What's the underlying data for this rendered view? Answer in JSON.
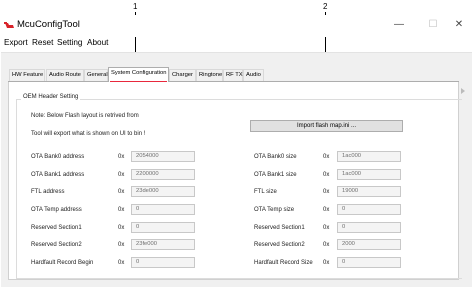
{
  "window": {
    "title": "McuConfigTool",
    "controls": {
      "minimize": "—",
      "maximize": "☐",
      "close": "✕"
    }
  },
  "menu": [
    "Export",
    "Reset",
    "Setting",
    "About"
  ],
  "tabs": [
    {
      "label": "HW Feature",
      "active": false
    },
    {
      "label": "Audio Route",
      "active": false
    },
    {
      "label": "General",
      "active": false
    },
    {
      "label": "System Configuration",
      "active": true
    },
    {
      "label": "Charger",
      "active": false
    },
    {
      "label": "Ringtone",
      "active": false
    },
    {
      "label": "RF TX",
      "active": false
    },
    {
      "label": "Audio",
      "active": false
    }
  ],
  "group": {
    "title": "OEM Header Setting",
    "note": "Note: Below Flash layout is retrived  from",
    "export_note": "Tool will export what is shown on UI to bin !",
    "import_button": "Import flash map.ini ..."
  },
  "hex_prefix": "0x",
  "left_fields": [
    {
      "label": "OTA Bank0 address",
      "value": "2054000"
    },
    {
      "label": "OTA Bank1 address",
      "value": "2200000"
    },
    {
      "label": "FTL address",
      "value": "23de000"
    },
    {
      "label": "OTA Temp address",
      "value": "0"
    },
    {
      "label": "Reserved Section1",
      "value": "0"
    },
    {
      "label": "Reserved Section2",
      "value": "23fe000"
    },
    {
      "label": "Hardfault Record Begin",
      "value": "0"
    }
  ],
  "right_fields": [
    {
      "label": "OTA Bank0 size",
      "value": "1ac000"
    },
    {
      "label": "OTA Bank1 size",
      "value": "1ac000"
    },
    {
      "label": "FTL size",
      "value": "19000"
    },
    {
      "label": "OTA Temp size",
      "value": "0"
    },
    {
      "label": "Reserved Section1",
      "value": "0"
    },
    {
      "label": "Reserved Section2",
      "value": "2000"
    },
    {
      "label": "Hardfault Record Size",
      "value": "0"
    }
  ],
  "annotations": [
    {
      "number": "1"
    },
    {
      "number": "2"
    }
  ],
  "colors": {
    "annotation_red": "#e8283c",
    "tab_active": "#ffffff",
    "window_bg": "#f0f0f0"
  }
}
